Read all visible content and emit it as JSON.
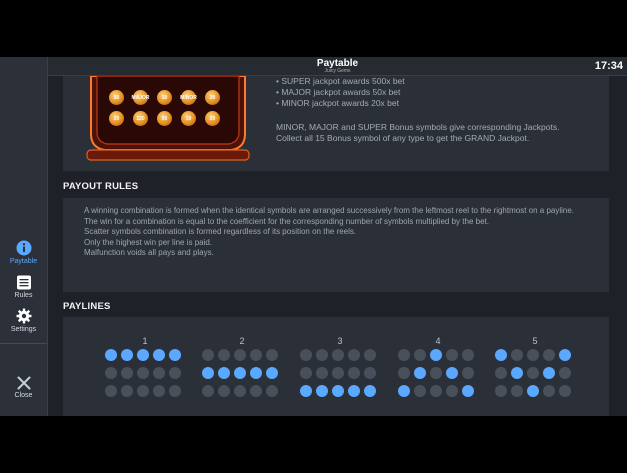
{
  "header": {
    "title": "Paytable",
    "subtitle": "Juicy Gems",
    "time": "17:34"
  },
  "sidebar": {
    "items": [
      {
        "label": "Paytable",
        "icon": "info-icon",
        "active": true
      },
      {
        "label": "Rules",
        "icon": "rules-icon",
        "active": false
      },
      {
        "label": "Settings",
        "icon": "gear-icon",
        "active": false
      }
    ],
    "close_label": "Close"
  },
  "bonus": {
    "lines": [
      "• SUPER jackpot awards 500x bet",
      "• MAJOR jackpot awards 50x bet",
      "• MINOR jackpot awards 20x bet"
    ],
    "paragraph_1": "MINOR, MAJOR and SUPER Bonus symbols give corresponding Jackpots.",
    "paragraph_2": "Collect all 15 Bonus symbol of any type to get the GRAND Jackpot.",
    "coins": [
      "50",
      "MAJOR",
      "10",
      "MINOR",
      "20",
      "20",
      "120",
      "50",
      "10",
      "20"
    ]
  },
  "payout_rules": {
    "title": "PAYOUT RULES",
    "lines": [
      "A winning combination is formed when the identical symbols are arranged successively from the leftmost reel to the rightmost on a payline.",
      "The win for a combination is equal to the coefficient for the corresponding number of symbols multiplied by the bet.",
      "Scatter symbols combination is formed regardless of its position on the reels.",
      "Only the highest win per line is paid.",
      "Malfunction voids all pays and plays."
    ]
  },
  "paylines": {
    "title": "PAYLINES",
    "lines": [
      {
        "number": "1",
        "rows": [
          1,
          1,
          1,
          1,
          1
        ]
      },
      {
        "number": "2",
        "rows": [
          2,
          2,
          2,
          2,
          2
        ]
      },
      {
        "number": "3",
        "rows": [
          3,
          3,
          3,
          3,
          3
        ]
      },
      {
        "number": "4",
        "rows": [
          3,
          2,
          1,
          2,
          3
        ]
      },
      {
        "number": "5",
        "rows": [
          1,
          2,
          3,
          2,
          1
        ]
      }
    ]
  },
  "colors": {
    "accent": "#5aa8ff",
    "inactive_dot": "#4a505b",
    "background": "#1e2127",
    "panel": "#2b2f37"
  }
}
